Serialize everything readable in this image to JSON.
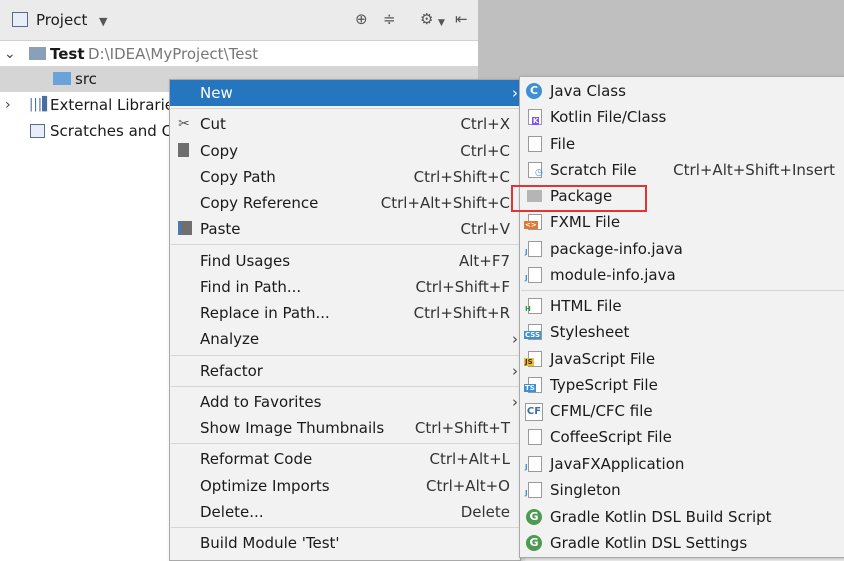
{
  "toolbar": {
    "title": "Project"
  },
  "tree": {
    "root_name": "Test",
    "root_path": "D:\\IDEA\\MyProject\\Test",
    "src": "src",
    "external_libraries": "External Libraries",
    "scratches": "Scratches and Co"
  },
  "context_menu": {
    "new": "New",
    "cut": "Cut",
    "cut_sc": "Ctrl+X",
    "copy": "Copy",
    "copy_sc": "Ctrl+C",
    "copy_path": "Copy Path",
    "copy_path_sc": "Ctrl+Shift+C",
    "copy_reference": "Copy Reference",
    "copy_reference_sc": "Ctrl+Alt+Shift+C",
    "paste": "Paste",
    "paste_sc": "Ctrl+V",
    "find_usages": "Find Usages",
    "find_usages_sc": "Alt+F7",
    "find_in_path": "Find in Path...",
    "find_in_path_sc": "Ctrl+Shift+F",
    "replace_in_path": "Replace in Path...",
    "replace_in_path_sc": "Ctrl+Shift+R",
    "analyze": "Analyze",
    "refactor": "Refactor",
    "add_to_favorites": "Add to Favorites",
    "show_image_thumbnails": "Show Image Thumbnails",
    "show_image_thumbnails_sc": "Ctrl+Shift+T",
    "reformat_code": "Reformat Code",
    "reformat_code_sc": "Ctrl+Alt+L",
    "optimize_imports": "Optimize Imports",
    "optimize_imports_sc": "Ctrl+Alt+O",
    "delete": "Delete...",
    "delete_sc": "Delete",
    "build_module": "Build Module 'Test'"
  },
  "new_submenu": {
    "java_class": "Java Class",
    "kotlin_file_class": "Kotlin File/Class",
    "file": "File",
    "scratch_file": "Scratch File",
    "scratch_file_sc": "Ctrl+Alt+Shift+Insert",
    "package": "Package",
    "fxml_file": "FXML File",
    "package_info": "package-info.java",
    "module_info": "module-info.java",
    "html_file": "HTML File",
    "stylesheet": "Stylesheet",
    "javascript_file": "JavaScript File",
    "typescript_file": "TypeScript File",
    "cfml_cfc_file": "CFML/CFC file",
    "coffeescript_file": "CoffeeScript File",
    "javafx_application": "JavaFXApplication",
    "singleton": "Singleton",
    "gradle_kotlin_build": "Gradle Kotlin DSL Build Script",
    "gradle_kotlin_settings": "Gradle Kotlin DSL Settings"
  },
  "colors": {
    "highlight": "#2675bf",
    "annotation": "#e03535",
    "selection": "#d5d5d5"
  }
}
